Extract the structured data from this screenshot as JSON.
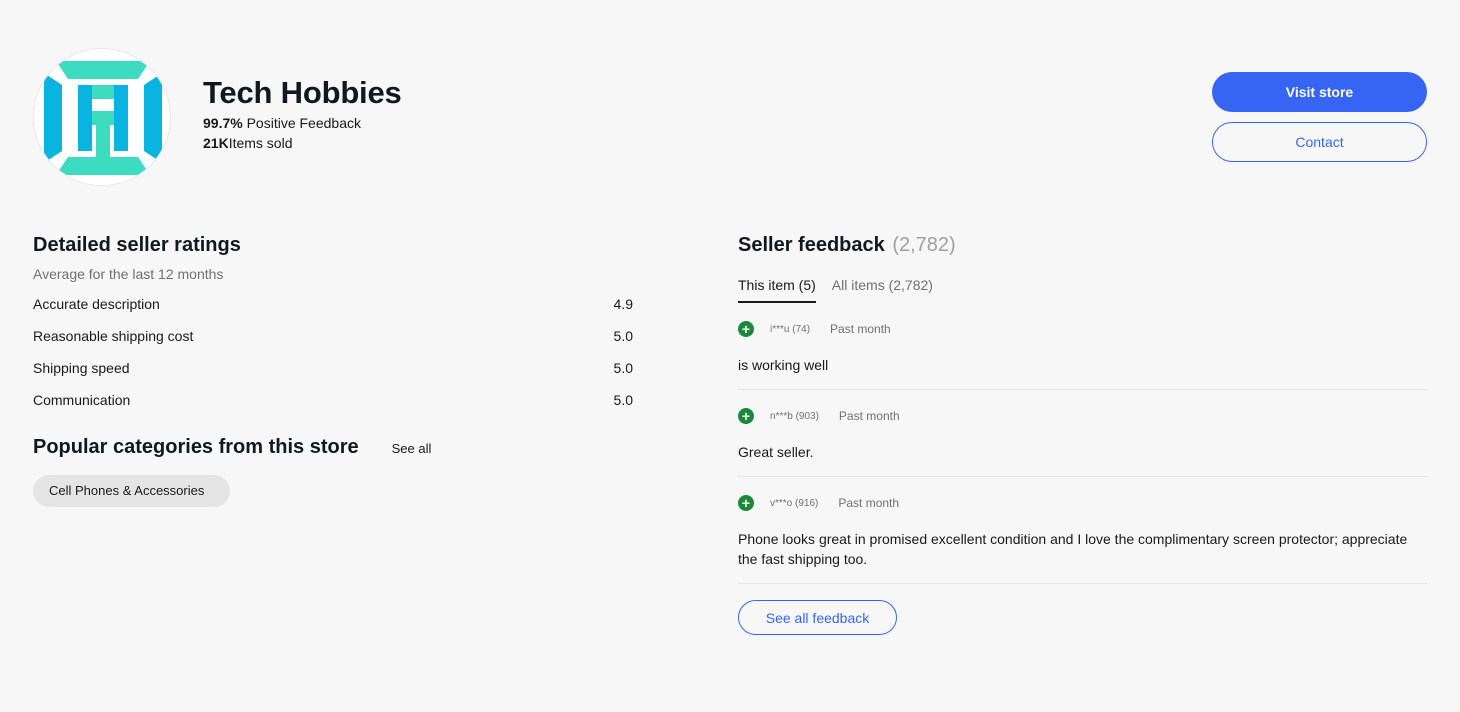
{
  "store": {
    "name": "Tech Hobbies",
    "feedback_percent": "99.7%",
    "feedback_label": "Positive Feedback",
    "items_sold_count": "21K",
    "items_sold_label": "Items sold",
    "logo_icon": "tech-hobbies-logo",
    "logo_colors": {
      "teal": "#3ddcc0",
      "blue": "#0ab4e0"
    }
  },
  "actions": {
    "visit_store": "Visit store",
    "contact": "Contact"
  },
  "ratings": {
    "title": "Detailed seller ratings",
    "subtitle": "Average for the last 12 months",
    "items": [
      {
        "label": "Accurate description",
        "value": "4.9"
      },
      {
        "label": "Reasonable shipping cost",
        "value": "5.0"
      },
      {
        "label": "Shipping speed",
        "value": "5.0"
      },
      {
        "label": "Communication",
        "value": "5.0"
      }
    ]
  },
  "popular": {
    "title": "Popular categories from this store",
    "see_all": "See all",
    "categories": [
      "Cell Phones & Accessories"
    ]
  },
  "feedback": {
    "title": "Seller feedback",
    "count": "(2,782)",
    "tabs": [
      {
        "label": "This item (5)",
        "active": true
      },
      {
        "label": "All items (2,782)",
        "active": false
      }
    ],
    "items": [
      {
        "user": "i***u (74)",
        "when": "Past month",
        "text": "is working well",
        "icon": "positive-plus-icon"
      },
      {
        "user": "n***b (903)",
        "when": "Past month",
        "text": "Great seller.",
        "icon": "positive-plus-icon"
      },
      {
        "user": "v***o (916)",
        "when": "Past month",
        "text": "Phone looks great in promised excellent condition and I love the complimentary screen protector; appreciate the fast shipping too.",
        "icon": "positive-plus-icon"
      }
    ],
    "see_all": "See all feedback"
  },
  "colors": {
    "accent": "#3665f3",
    "positive": "#1a8a3a",
    "background": "#f7f7f7"
  }
}
